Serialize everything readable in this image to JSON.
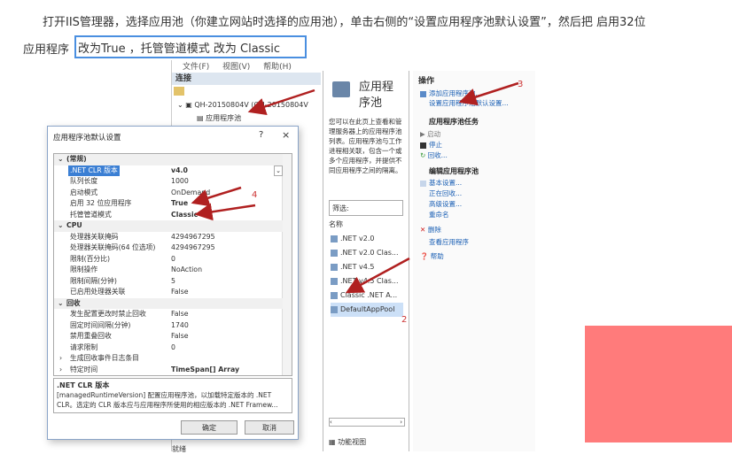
{
  "article": {
    "line1": "打开IIS管理器，选择应用池（你建立网站时选择的应用池），单击右侧的“设置应用程序池默认设置”，然后把 启用32位",
    "line2_prefix": "应用程序",
    "line2_highlight": "改为True ，托管管道模式 改为 Classic"
  },
  "iis": {
    "menu": [
      "文件(F)",
      "视图(V)",
      "帮助(H)"
    ],
    "connections_header": "连接",
    "tree_server": "QH-20150804V (QH-20150804V",
    "tree_pools": "应用程序池",
    "marker1": "1",
    "pane_title_l1": "应用程",
    "pane_title_l2": "序池",
    "description": "您可以在此页上查看和管理服务器上的应用程序池列表。应用程序池与工作进程相关联，包含一个或多个应用程序，并提供不同应用程序之间的隔离。",
    "filter_label": "筛选:",
    "name_header": "名称",
    "pools": [
      ".NET v2.0",
      ".NET v2.0 Clas...",
      ".NET v4.5",
      ".NET v4.5 Clas...",
      "Classic .NET A...",
      "DefaultAppPool"
    ],
    "feature_view": "功能视图",
    "status": "就绪",
    "actions": {
      "header": "操作",
      "add_pool": "添加应用程序池...",
      "set_defaults": "设置应用程序池默认设置...",
      "marker3": "3",
      "tasks_header": "应用程序池任务",
      "start": "启动",
      "stop": "停止",
      "recycle": "回收...",
      "edit_header": "编辑应用程序池",
      "basic": "基本设置...",
      "recycling": "正在回收...",
      "advanced": "高级设置...",
      "rename": "重命名",
      "delete": "删除",
      "view_apps": "查看应用程序",
      "help": "帮助"
    },
    "marker2": "2"
  },
  "dialog": {
    "title": "应用程序池默认设置",
    "help": "?",
    "close": "×",
    "marker4": "4",
    "rows": [
      {
        "k": "(常规)",
        "v": "",
        "cat": true
      },
      {
        "k": ".NET CLR 版本",
        "v": "v4.0",
        "sel": true,
        "bold": true
      },
      {
        "k": "队列长度",
        "v": "1000"
      },
      {
        "k": "启动模式",
        "v": "OnDemand"
      },
      {
        "k": "启用 32 位应用程序",
        "v": "True",
        "bold": true
      },
      {
        "k": "托管管道模式",
        "v": "Classic",
        "bold": true
      },
      {
        "k": "CPU",
        "v": "",
        "cat": true
      },
      {
        "k": "处理器关联掩码",
        "v": "4294967295"
      },
      {
        "k": "处理器关联掩码(64 位选项)",
        "v": "4294967295"
      },
      {
        "k": "限制(百分比)",
        "v": "0"
      },
      {
        "k": "限制操作",
        "v": "NoAction"
      },
      {
        "k": "限制间隔(分钟)",
        "v": "5"
      },
      {
        "k": "已启用处理器关联",
        "v": "False"
      },
      {
        "k": "回收",
        "v": "",
        "cat": true
      },
      {
        "k": "发生配置更改时禁止回收",
        "v": "False"
      },
      {
        "k": "固定时间间隔(分钟)",
        "v": "1740"
      },
      {
        "k": "禁用重叠回收",
        "v": "False"
      },
      {
        "k": "请求限制",
        "v": "0"
      },
      {
        "k": "生成回收事件日志条目",
        "v": "",
        "sub": true
      },
      {
        "k": "特定时间",
        "v": "TimeSpan[] Array",
        "sub": true,
        "bold": true
      }
    ],
    "desc_title": ".NET CLR 版本",
    "desc_body": "[managedRuntimeVersion] 配置应用程序池，以加载特定版本的 .NET CLR。选定的 CLR 版本应与应用程序所使用的相应版本的 .NET Framew...",
    "ok": "确定",
    "cancel": "取消"
  },
  "colors": {
    "highlight_border": "#4a8fe0",
    "arrow": "#b02020",
    "pink_block": "#ff7b7b",
    "selection": "#3b7fd4"
  }
}
